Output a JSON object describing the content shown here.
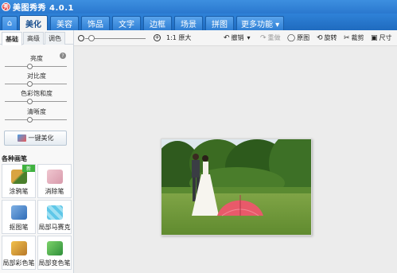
{
  "app": {
    "title": "美图秀秀 4.0.1",
    "logo_char": "秀"
  },
  "nav": {
    "home_icon": "home-icon",
    "tabs": [
      {
        "label": "美化",
        "active": true
      },
      {
        "label": "美容"
      },
      {
        "label": "饰品"
      },
      {
        "label": "文字"
      },
      {
        "label": "边框"
      },
      {
        "label": "场景"
      },
      {
        "label": "拼图"
      },
      {
        "label": "更多功能 ▾"
      }
    ]
  },
  "left": {
    "subtabs": [
      "基础",
      "高级",
      "调色"
    ],
    "sliders": [
      {
        "label": "亮度",
        "value": 0.5
      },
      {
        "label": "对比度",
        "value": 0.5
      },
      {
        "label": "色彩饱和度",
        "value": 0.5
      },
      {
        "label": "清晰度",
        "value": 0.5
      }
    ],
    "one_click": "一键美化",
    "brush_heading": "各种画笔",
    "brushes": [
      {
        "label": "涂鸦笔",
        "badge": "新"
      },
      {
        "label": "消除笔"
      },
      {
        "label": "抠图笔"
      },
      {
        "label": "局部马赛克"
      },
      {
        "label": "局部彩色笔"
      },
      {
        "label": "局部变色笔"
      }
    ]
  },
  "toolbar": {
    "zoom_label": "1:1 原大",
    "undo": "撤销",
    "redo": "重做",
    "original": "原图",
    "rotate": "旋转",
    "crop": "裁剪",
    "size": "尺寸"
  },
  "colors": {
    "accent": "#2a78cf",
    "umbrella": "#e85a6a"
  }
}
